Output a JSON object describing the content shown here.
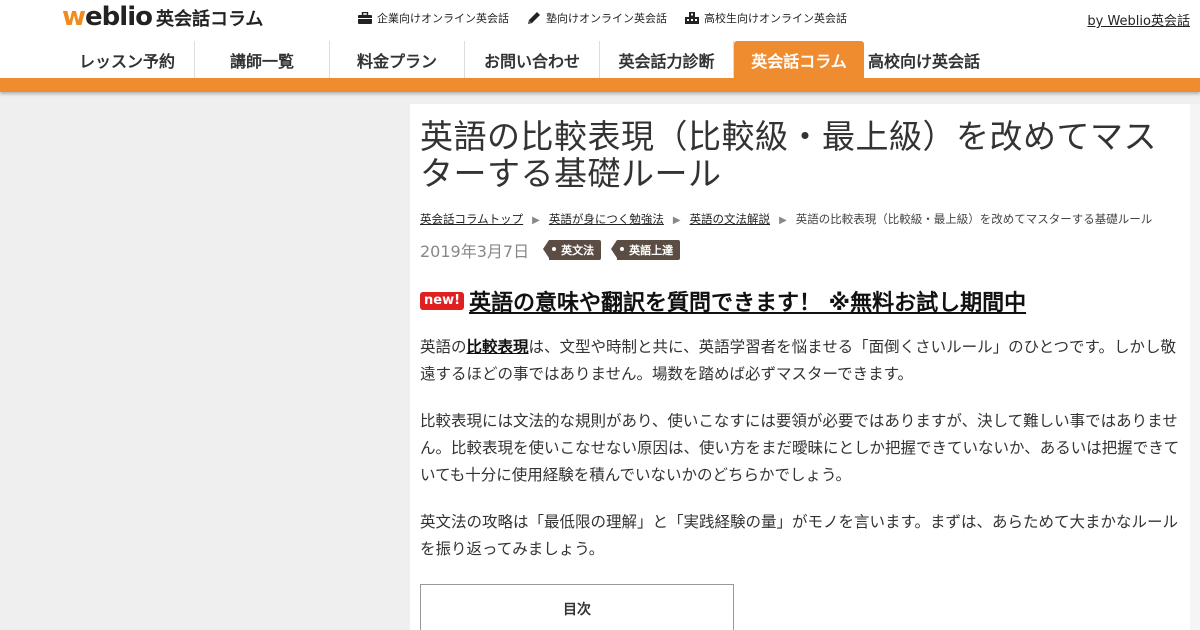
{
  "header": {
    "logo_w": "w",
    "logo_eblio": "eblio",
    "logo_sub": "英会話コラム",
    "top_links": [
      {
        "label": "企業向けオンライン英会話",
        "icon": "briefcase-icon"
      },
      {
        "label": "塾向けオンライン英会話",
        "icon": "pencil-icon"
      },
      {
        "label": "高校生向けオンライン英会話",
        "icon": "school-icon"
      }
    ],
    "by_link": "by Weblio英会話"
  },
  "nav": {
    "items": [
      {
        "label": "レッスン予約"
      },
      {
        "label": "講師一覧"
      },
      {
        "label": "料金プラン"
      },
      {
        "label": "お問い合わせ"
      },
      {
        "label": "英会話力診断"
      },
      {
        "label": "英会話コラム",
        "active": true
      },
      {
        "label": "高校向け英会話"
      }
    ]
  },
  "article": {
    "title": "英語の比較表現（比較級・最上級）を改めてマスターする基礎ルール",
    "breadcrumb": {
      "items": [
        "英会話コラムトップ",
        "英語が身につく勉強法",
        "英語の文法解説"
      ],
      "current": "英語の比較表現（比較級・最上級）を改めてマスターする基礎ルール",
      "separator": "▶"
    },
    "date": "2019年3月7日",
    "tags": [
      "英文法",
      "英語上達"
    ],
    "promo": {
      "badge": "new!",
      "link": "英語の意味や翻訳を質問できます！ ※無料お試し期間中"
    },
    "para1": {
      "pre": "英語の",
      "link": "比較表現",
      "post": "は、文型や時制と共に、英語学習者を悩ませる「面倒くさいルール」のひとつです。しかし敬遠するほどの事ではありません。場数を踏めば必ずマスターできます。"
    },
    "para2": "比較表現には文法的な規則があり、使いこなすには要領が必要ではありますが、決して難しい事ではありません。比較表現を使いこなせない原因は、使い方をまだ曖昧にとしか把握できていないか、あるいは把握できていても十分に使用経験を積んでいないかのどちらかでしょう。",
    "para3": "英文法の攻略は「最低限の理解」と「実践経験の量」がモノを言います。まずは、あらためて大まかなルールを振り返ってみましょう。",
    "toc_title": "目次"
  },
  "colors": {
    "accent": "#f08c30",
    "tag_bg": "#5c4d44",
    "new_badge": "#e02020"
  }
}
